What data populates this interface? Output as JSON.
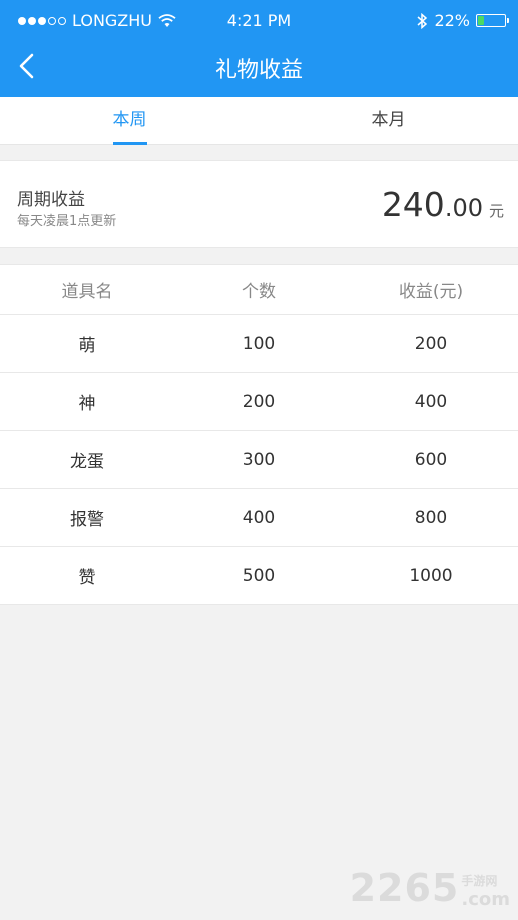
{
  "status_bar": {
    "carrier": "LONGZHU",
    "time": "4:21 PM",
    "battery": "22%",
    "battery_level": 0.22,
    "icons": [
      "signal-dots",
      "wifi-icon",
      "bluetooth-icon",
      "battery-icon"
    ]
  },
  "nav": {
    "title": "礼物收益",
    "back_icon": "chevron-left-icon"
  },
  "tabs": [
    {
      "label": "本周",
      "active": true
    },
    {
      "label": "本月",
      "active": false
    }
  ],
  "summary": {
    "title": "周期收益",
    "subtitle": "每天凌晨1点更新",
    "amount_int": "240",
    "amount_dec": ".00",
    "unit": "元"
  },
  "table": {
    "headers": [
      "道具名",
      "个数",
      "收益(元)"
    ],
    "rows": [
      [
        "萌",
        "100",
        "200"
      ],
      [
        "神",
        "200",
        "400"
      ],
      [
        "龙蛋",
        "300",
        "600"
      ],
      [
        "报警",
        "400",
        "800"
      ],
      [
        "赞",
        "500",
        "1000"
      ]
    ]
  },
  "watermark": {
    "number": "2265",
    "cn": "手游网",
    "com": ".com"
  },
  "colors": {
    "accent": "#2196f3",
    "background": "#f2f2f2"
  }
}
